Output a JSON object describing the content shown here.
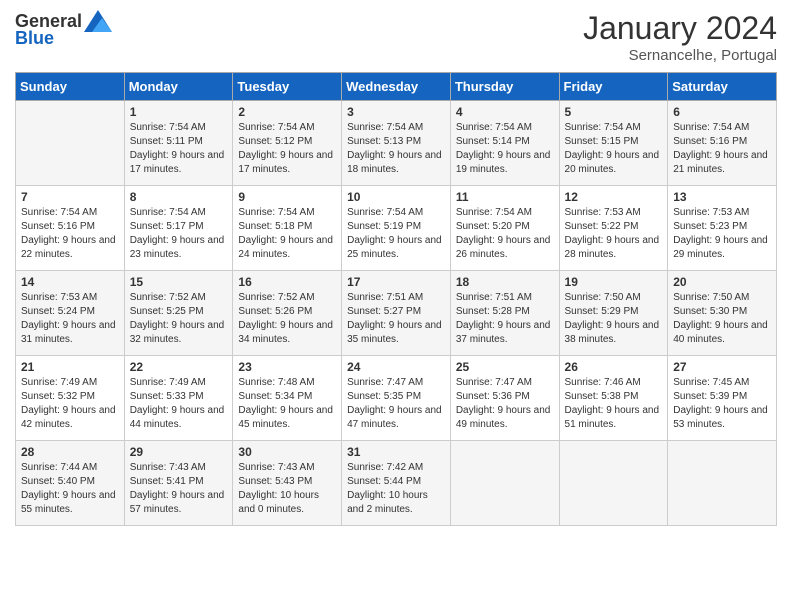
{
  "header": {
    "logo": {
      "general": "General",
      "blue": "Blue"
    },
    "title": "January 2024",
    "location": "Sernancelhe, Portugal"
  },
  "days_of_week": [
    "Sunday",
    "Monday",
    "Tuesday",
    "Wednesday",
    "Thursday",
    "Friday",
    "Saturday"
  ],
  "weeks": [
    [
      {
        "day": "",
        "sunrise": "",
        "sunset": "",
        "daylight": ""
      },
      {
        "day": "1",
        "sunrise": "Sunrise: 7:54 AM",
        "sunset": "Sunset: 5:11 PM",
        "daylight": "Daylight: 9 hours and 17 minutes."
      },
      {
        "day": "2",
        "sunrise": "Sunrise: 7:54 AM",
        "sunset": "Sunset: 5:12 PM",
        "daylight": "Daylight: 9 hours and 17 minutes."
      },
      {
        "day": "3",
        "sunrise": "Sunrise: 7:54 AM",
        "sunset": "Sunset: 5:13 PM",
        "daylight": "Daylight: 9 hours and 18 minutes."
      },
      {
        "day": "4",
        "sunrise": "Sunrise: 7:54 AM",
        "sunset": "Sunset: 5:14 PM",
        "daylight": "Daylight: 9 hours and 19 minutes."
      },
      {
        "day": "5",
        "sunrise": "Sunrise: 7:54 AM",
        "sunset": "Sunset: 5:15 PM",
        "daylight": "Daylight: 9 hours and 20 minutes."
      },
      {
        "day": "6",
        "sunrise": "Sunrise: 7:54 AM",
        "sunset": "Sunset: 5:16 PM",
        "daylight": "Daylight: 9 hours and 21 minutes."
      }
    ],
    [
      {
        "day": "7",
        "sunrise": "Sunrise: 7:54 AM",
        "sunset": "Sunset: 5:16 PM",
        "daylight": "Daylight: 9 hours and 22 minutes."
      },
      {
        "day": "8",
        "sunrise": "Sunrise: 7:54 AM",
        "sunset": "Sunset: 5:17 PM",
        "daylight": "Daylight: 9 hours and 23 minutes."
      },
      {
        "day": "9",
        "sunrise": "Sunrise: 7:54 AM",
        "sunset": "Sunset: 5:18 PM",
        "daylight": "Daylight: 9 hours and 24 minutes."
      },
      {
        "day": "10",
        "sunrise": "Sunrise: 7:54 AM",
        "sunset": "Sunset: 5:19 PM",
        "daylight": "Daylight: 9 hours and 25 minutes."
      },
      {
        "day": "11",
        "sunrise": "Sunrise: 7:54 AM",
        "sunset": "Sunset: 5:20 PM",
        "daylight": "Daylight: 9 hours and 26 minutes."
      },
      {
        "day": "12",
        "sunrise": "Sunrise: 7:53 AM",
        "sunset": "Sunset: 5:22 PM",
        "daylight": "Daylight: 9 hours and 28 minutes."
      },
      {
        "day": "13",
        "sunrise": "Sunrise: 7:53 AM",
        "sunset": "Sunset: 5:23 PM",
        "daylight": "Daylight: 9 hours and 29 minutes."
      }
    ],
    [
      {
        "day": "14",
        "sunrise": "Sunrise: 7:53 AM",
        "sunset": "Sunset: 5:24 PM",
        "daylight": "Daylight: 9 hours and 31 minutes."
      },
      {
        "day": "15",
        "sunrise": "Sunrise: 7:52 AM",
        "sunset": "Sunset: 5:25 PM",
        "daylight": "Daylight: 9 hours and 32 minutes."
      },
      {
        "day": "16",
        "sunrise": "Sunrise: 7:52 AM",
        "sunset": "Sunset: 5:26 PM",
        "daylight": "Daylight: 9 hours and 34 minutes."
      },
      {
        "day": "17",
        "sunrise": "Sunrise: 7:51 AM",
        "sunset": "Sunset: 5:27 PM",
        "daylight": "Daylight: 9 hours and 35 minutes."
      },
      {
        "day": "18",
        "sunrise": "Sunrise: 7:51 AM",
        "sunset": "Sunset: 5:28 PM",
        "daylight": "Daylight: 9 hours and 37 minutes."
      },
      {
        "day": "19",
        "sunrise": "Sunrise: 7:50 AM",
        "sunset": "Sunset: 5:29 PM",
        "daylight": "Daylight: 9 hours and 38 minutes."
      },
      {
        "day": "20",
        "sunrise": "Sunrise: 7:50 AM",
        "sunset": "Sunset: 5:30 PM",
        "daylight": "Daylight: 9 hours and 40 minutes."
      }
    ],
    [
      {
        "day": "21",
        "sunrise": "Sunrise: 7:49 AM",
        "sunset": "Sunset: 5:32 PM",
        "daylight": "Daylight: 9 hours and 42 minutes."
      },
      {
        "day": "22",
        "sunrise": "Sunrise: 7:49 AM",
        "sunset": "Sunset: 5:33 PM",
        "daylight": "Daylight: 9 hours and 44 minutes."
      },
      {
        "day": "23",
        "sunrise": "Sunrise: 7:48 AM",
        "sunset": "Sunset: 5:34 PM",
        "daylight": "Daylight: 9 hours and 45 minutes."
      },
      {
        "day": "24",
        "sunrise": "Sunrise: 7:47 AM",
        "sunset": "Sunset: 5:35 PM",
        "daylight": "Daylight: 9 hours and 47 minutes."
      },
      {
        "day": "25",
        "sunrise": "Sunrise: 7:47 AM",
        "sunset": "Sunset: 5:36 PM",
        "daylight": "Daylight: 9 hours and 49 minutes."
      },
      {
        "day": "26",
        "sunrise": "Sunrise: 7:46 AM",
        "sunset": "Sunset: 5:38 PM",
        "daylight": "Daylight: 9 hours and 51 minutes."
      },
      {
        "day": "27",
        "sunrise": "Sunrise: 7:45 AM",
        "sunset": "Sunset: 5:39 PM",
        "daylight": "Daylight: 9 hours and 53 minutes."
      }
    ],
    [
      {
        "day": "28",
        "sunrise": "Sunrise: 7:44 AM",
        "sunset": "Sunset: 5:40 PM",
        "daylight": "Daylight: 9 hours and 55 minutes."
      },
      {
        "day": "29",
        "sunrise": "Sunrise: 7:43 AM",
        "sunset": "Sunset: 5:41 PM",
        "daylight": "Daylight: 9 hours and 57 minutes."
      },
      {
        "day": "30",
        "sunrise": "Sunrise: 7:43 AM",
        "sunset": "Sunset: 5:43 PM",
        "daylight": "Daylight: 10 hours and 0 minutes."
      },
      {
        "day": "31",
        "sunrise": "Sunrise: 7:42 AM",
        "sunset": "Sunset: 5:44 PM",
        "daylight": "Daylight: 10 hours and 2 minutes."
      },
      {
        "day": "",
        "sunrise": "",
        "sunset": "",
        "daylight": ""
      },
      {
        "day": "",
        "sunrise": "",
        "sunset": "",
        "daylight": ""
      },
      {
        "day": "",
        "sunrise": "",
        "sunset": "",
        "daylight": ""
      }
    ]
  ]
}
